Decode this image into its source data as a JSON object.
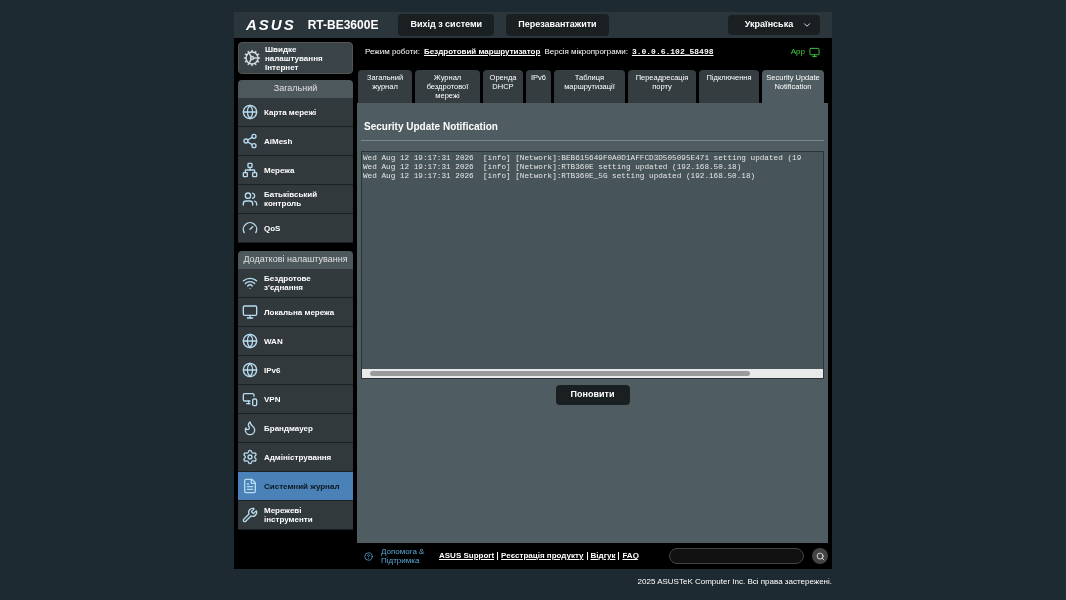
{
  "header": {
    "brand": "ASUS",
    "model": "RT-BE3600E",
    "buttons": [
      "Вихід з системи",
      "Перезавантажити"
    ],
    "language": "Українська"
  },
  "status": {
    "mode_label": "Режим роботи:",
    "mode": "Бездротовий маршрутизатор",
    "firmware_label": "Версія мікропрограми:",
    "firmware": "3.0.0.6.102_58498",
    "app": "App"
  },
  "sidebar": {
    "quick_setup": "Швидке налаштування Інтернет",
    "sections": [
      {
        "title": "Загальний",
        "items": [
          {
            "label": "Карта мережі",
            "selected": false
          },
          {
            "label": "AiMesh",
            "selected": false
          },
          {
            "label": "Мережа",
            "selected": false
          },
          {
            "label": "Батьківський контроль",
            "selected": false
          },
          {
            "label": "QoS",
            "selected": false
          }
        ]
      },
      {
        "title": "Додаткові налаштування",
        "items": [
          {
            "label": "Бездротове з'єднання",
            "selected": false
          },
          {
            "label": "Локальна мережа",
            "selected": false
          },
          {
            "label": "WAN",
            "selected": false
          },
          {
            "label": "IPv6",
            "selected": false
          },
          {
            "label": "VPN",
            "selected": false
          },
          {
            "label": "Брандмауер",
            "selected": false
          },
          {
            "label": "Адміністрування",
            "selected": false
          },
          {
            "label": "Системний журнал",
            "selected": true
          },
          {
            "label": "Мережеві інструменти",
            "selected": false
          }
        ]
      }
    ]
  },
  "tabs": [
    {
      "label": "Загальний журнал",
      "selected": false
    },
    {
      "label": "Журнал бездротової мережі",
      "selected": false
    },
    {
      "label": "Оренда DHCP",
      "selected": false
    },
    {
      "label": "IPv6",
      "selected": false
    },
    {
      "label": "Таблиця маршрутизації",
      "selected": false
    },
    {
      "label": "Переадресація порту",
      "selected": false
    },
    {
      "label": "Підключення",
      "selected": false
    },
    {
      "label": "Security Update Notification",
      "selected": true
    }
  ],
  "panel": {
    "title": "Security Update Notification",
    "log_lines": [
      "Wed Aug 12 19:17:31 2026  [info] [Network]:BEB615649F0A0D1AFFCD3D505095E471 setting updated (19",
      "Wed Aug 12 19:17:31 2026  [info] [Network]:RTB360E setting updated (192.168.50.18)",
      "Wed Aug 12 19:17:31 2026  [info] [Network]:RTB360E_5G setting updated (192.168.50.18)"
    ],
    "button": "Поновити"
  },
  "footer": {
    "help": "Допомога & Підтримка",
    "links": [
      "ASUS Support",
      "Реєстрація продукту",
      "Відгук",
      "FAQ"
    ],
    "copyright": "2025 ASUSTeK Computer Inc. Всі права застережені."
  }
}
